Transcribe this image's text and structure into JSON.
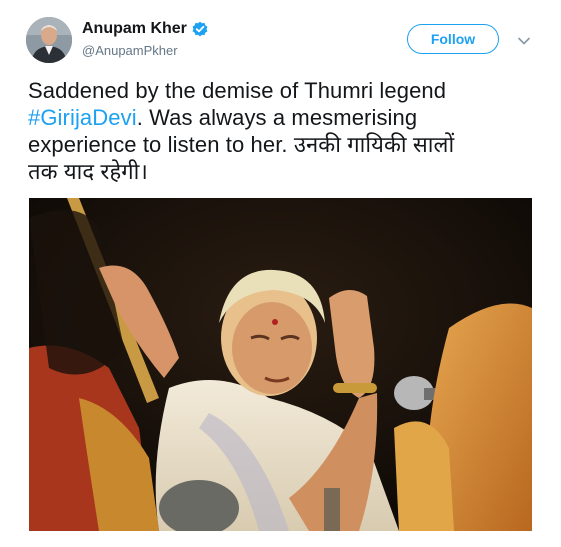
{
  "user": {
    "display_name": "Anupam Kher",
    "handle": "@AnupamPkher",
    "verified": true,
    "avatar_icon": "profile-photo"
  },
  "actions": {
    "follow_label": "Follow",
    "more_icon": "chevron-down-icon"
  },
  "tweet": {
    "line1": "Saddened by the demise of Thumri legend",
    "hashtag": "#GirijaDevi",
    "line2_rest": ". Was always a mesmerising",
    "line3": "experience to listen to her. उनकी गायिकी सालों",
    "line4": "तक याद रहेगी।"
  },
  "media": {
    "type": "photo",
    "subject": "singer-performing-photo"
  },
  "colors": {
    "accent": "#1da1f2",
    "text": "#14171a",
    "secondary": "#657786"
  }
}
